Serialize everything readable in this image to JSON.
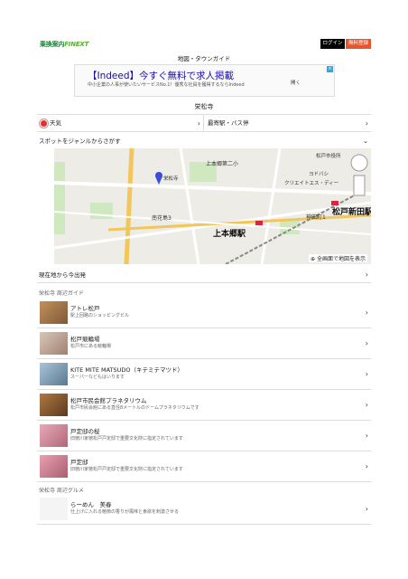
{
  "header": {
    "logo_main": "乗換案内",
    "logo_brand": "FINEXT",
    "login_label": "ログイン",
    "register_label": "無料登録",
    "subtitle": "地図・タウンガイド"
  },
  "ad": {
    "title": "【Indeed】今すぐ無料で求人掲載",
    "description": "中小企業の人事が使いたいサービスNo.1！優秀な社員を獲得するならIndeed",
    "open_label": "開く",
    "close_label": "×"
  },
  "place": {
    "name": "栄松寺"
  },
  "quick_links": {
    "weather": "天気",
    "nearest_station": "最寄駅・バス停"
  },
  "genre_search": "スポットをジャンルからさがす",
  "map": {
    "labels": [
      {
        "text": "上本郷第二小"
      },
      {
        "text": "栄松寺"
      },
      {
        "text": "南花島3"
      },
      {
        "text": "上本郷駅"
      },
      {
        "text": "松戸新田駅"
      },
      {
        "text": "ヨドバシ"
      },
      {
        "text": "神田町1"
      },
      {
        "text": "クリエイトエス・ディー"
      },
      {
        "text": "松戸市役所"
      }
    ],
    "full_screen_label": "全画面で地図を表示"
  },
  "route_from_here": "現在地から今出発",
  "guide": {
    "section_title": "栄松寺 周辺ガイド",
    "items": [
      {
        "name": "アトレ松戸",
        "desc": "駅上回路のショッピングビル"
      },
      {
        "name": "松戸競輪場",
        "desc": "松戸市にある競輪場"
      },
      {
        "name": "KITE MITE MATSUDO（キテミテマツド）",
        "desc": "スーパーなどもはいります"
      },
      {
        "name": "松戸市民会館プラネタリウム",
        "desc": "松戸市民会館にある直径8メートルのドームプラネタリウムです"
      },
      {
        "name": "戸定邸の桜",
        "desc": "旧徳川家徳松戸戸定邸で重要文化財に指定されています"
      },
      {
        "name": "戸定邸",
        "desc": "旧徳川家徳松戸戸定邸で重要文化財に指定されています"
      }
    ]
  },
  "gourmet": {
    "section_title": "栄松寺 周辺グルメ",
    "items": [
      {
        "name": "らーめん　美春",
        "desc": "仕上げに入れる鮭節の香りが風味と食欲を刺激させる"
      }
    ]
  },
  "colors": {
    "login_bg": "#000000",
    "register_bg": "#e4572e",
    "link_blue": "#1a0dab",
    "station_red": "#d7263d"
  }
}
